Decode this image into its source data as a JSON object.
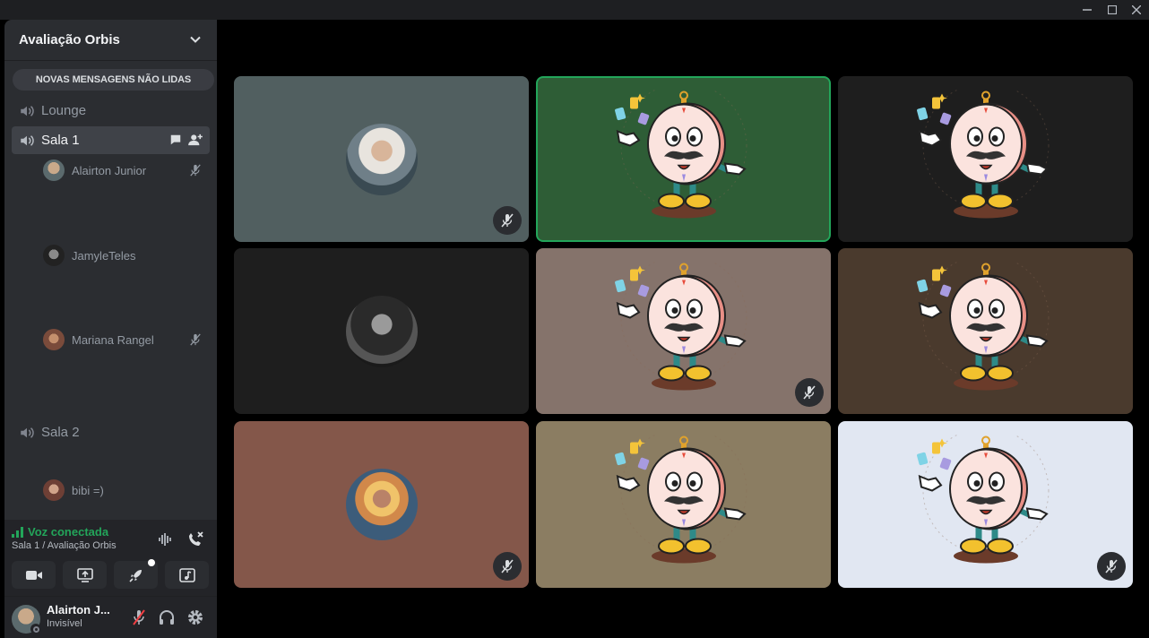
{
  "window": {
    "minimize_icon": "minimize-icon",
    "maximize_icon": "maximize-icon",
    "close_icon": "close-icon"
  },
  "server": {
    "name": "Avaliação Orbis"
  },
  "banner": {
    "new_messages": "NOVAS MENSAGENS NÃO LIDAS"
  },
  "channels": [
    {
      "name": "Lounge"
    },
    {
      "name": "Sala 1",
      "members": [
        {
          "name": "Alairton Junior",
          "muted": true
        },
        {
          "name": "JamyleTeles",
          "muted": false
        },
        {
          "name": "Mariana Rangel",
          "muted": true
        }
      ]
    },
    {
      "name": "Sala 2",
      "members": [
        {
          "name": "bibi =)",
          "muted": false
        }
      ]
    }
  ],
  "voice": {
    "status": "Voz conectada",
    "location": "Sala 1 / Avaliação Orbis"
  },
  "user": {
    "name": "Alairton J...",
    "status": "Invisível"
  },
  "tiles": [
    {
      "bg": "#515f60",
      "kind": "photo",
      "muted": true,
      "speaking": false
    },
    {
      "bg": "#2e5d36",
      "kind": "mascot",
      "muted": false,
      "speaking": true
    },
    {
      "bg": "#1e1e1e",
      "kind": "mascot",
      "muted": false,
      "speaking": false
    },
    {
      "bg": "#1e1e1e",
      "kind": "photo",
      "muted": false,
      "speaking": false
    },
    {
      "bg": "#85736b",
      "kind": "mascot",
      "muted": true,
      "speaking": false
    },
    {
      "bg": "#4a3a2d",
      "kind": "mascot",
      "muted": false,
      "speaking": false
    },
    {
      "bg": "#84574a",
      "kind": "photo",
      "muted": true,
      "speaking": false
    },
    {
      "bg": "#8b7d62",
      "kind": "mascot",
      "muted": false,
      "speaking": false
    },
    {
      "bg": "#e1e7f2",
      "kind": "mascot",
      "muted": true,
      "speaking": false
    }
  ],
  "colors": {
    "accent_green": "#23a55a",
    "sidebar": "#2b2d31",
    "panel": "#232428",
    "muted_red": "#f23f43"
  }
}
